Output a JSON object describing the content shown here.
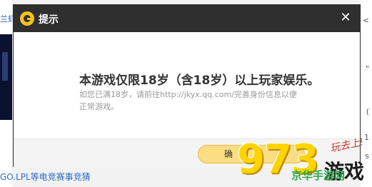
{
  "background": {
    "left_link_text": "兰虾",
    "bottom_link_text": "GO.LPL等电竞赛事竞猜",
    "right_marks": [
      "<",
      "\"",
      "(",
      "1",
      "s"
    ]
  },
  "dialog": {
    "title": "提示",
    "close_glyph": "✕",
    "message_main": "本游戏仅限18岁（含18岁）以上玩家娱乐。",
    "message_sub": "如您已满18岁，请前往http://jkyx.qq.com/完善身份信息以便正常游戏。",
    "confirm_label": "确"
  },
  "watermark": {
    "digits": [
      "9",
      "7",
      "3"
    ],
    "slogan": "玩去上!",
    "site_text": "京华手游网",
    "youxi_text": "游戏"
  },
  "colors": {
    "header_bg": "#2f2f2f",
    "logo_accent": "#f7c21c",
    "confirm_bg": "#fbdd82",
    "watermark_digit": "#ffd400"
  }
}
